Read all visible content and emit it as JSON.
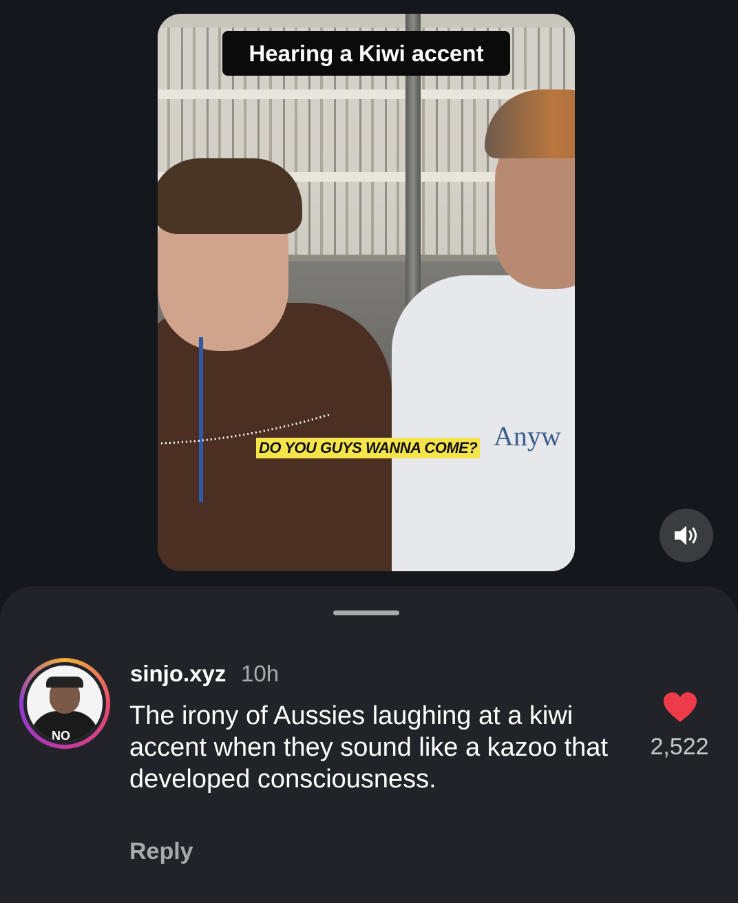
{
  "video": {
    "caption_top": "Hearing a Kiwi accent",
    "subtitle": "DO YOU GUYS WANNA COME?",
    "shirt_text": "Anyw",
    "sound_button": "speaker-icon"
  },
  "comments_sheet": {
    "comment": {
      "username": "sinjo.xyz",
      "time": "10h",
      "text": "The irony of Aussies laughing at a kiwi accent when they sound like a kazoo that developed consciousness.",
      "reply_label": "Reply",
      "like_count": "2,522",
      "avatar_text": "NO",
      "heart_color": "#ee3b4a"
    }
  }
}
